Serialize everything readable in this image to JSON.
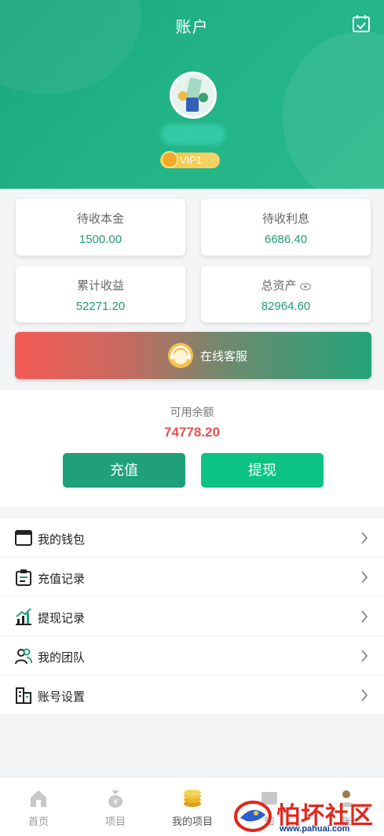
{
  "header": {
    "title": "账户",
    "vip_label": "VIP1"
  },
  "stats": [
    {
      "label": "待收本金",
      "value": "1500.00"
    },
    {
      "label": "待收利息",
      "value": "6686.40"
    },
    {
      "label": "累计收益",
      "value": "52271.20"
    },
    {
      "label": "总资产",
      "value": "82964.60"
    }
  ],
  "service": {
    "label": "在线客服"
  },
  "balance": {
    "label": "可用余额",
    "amount": "74778.20",
    "recharge_label": "充值",
    "withdraw_label": "提现"
  },
  "menu": [
    {
      "label": "我的钱包",
      "icon": "wallet-icon"
    },
    {
      "label": "充值记录",
      "icon": "recharge-record-icon"
    },
    {
      "label": "提现记录",
      "icon": "withdraw-record-icon"
    },
    {
      "label": "我的团队",
      "icon": "team-icon"
    },
    {
      "label": "账号设置",
      "icon": "settings-icon"
    }
  ],
  "tabbar": [
    {
      "label": "首页",
      "icon": "home-icon"
    },
    {
      "label": "项目",
      "icon": "money-bag-icon"
    },
    {
      "label": "我的项目",
      "icon": "coins-icon"
    },
    {
      "label": "知",
      "icon": "notice-icon"
    },
    {
      "label": "账",
      "icon": "account-icon"
    }
  ],
  "watermark": {
    "text": "怕坏社区",
    "url": "www.pahuai.com"
  },
  "colors": {
    "primary": "#1fa07a",
    "accent_red": "#e5524e",
    "withdraw": "#0dc383"
  }
}
